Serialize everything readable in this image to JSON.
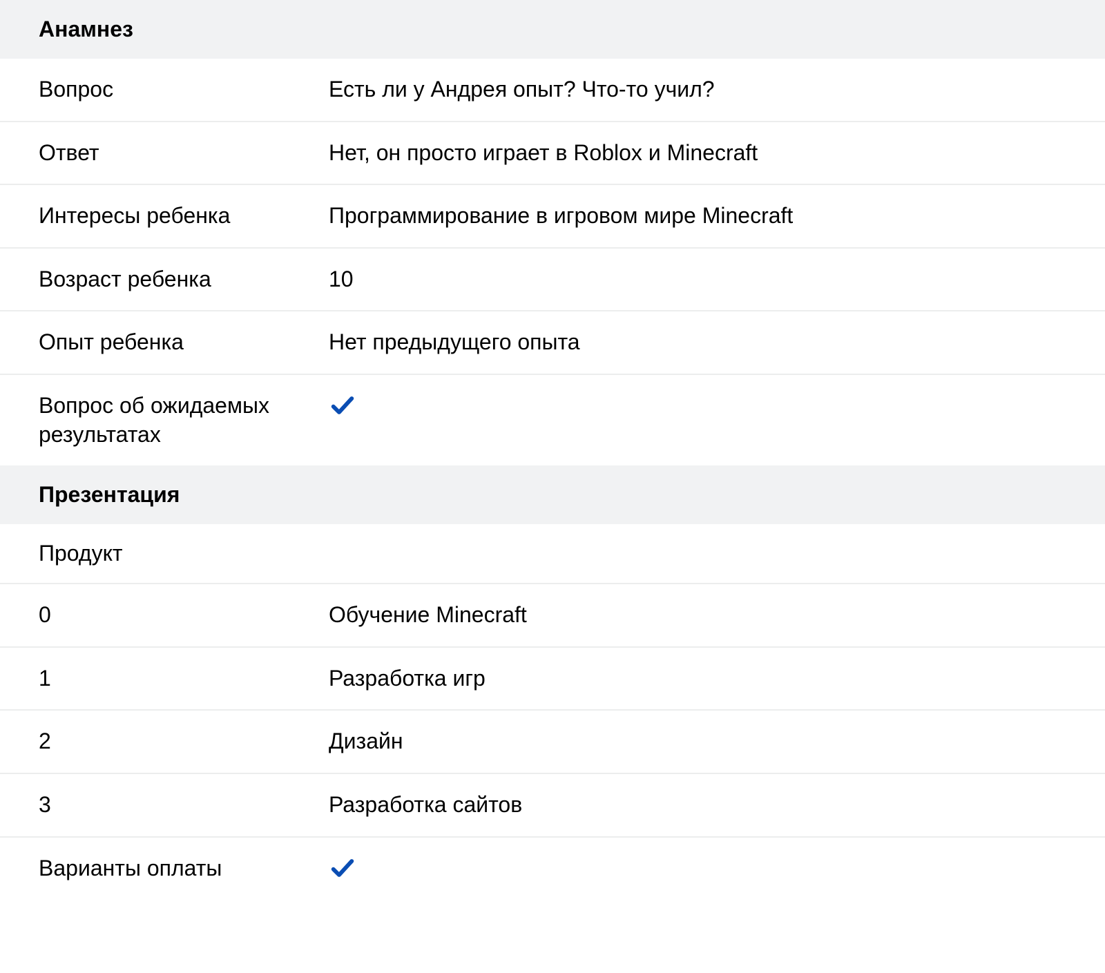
{
  "sections": {
    "anamnesis": {
      "title": "Анамнез",
      "rows": [
        {
          "label": "Вопрос",
          "value": "Есть ли у Андрея опыт? Что-то учил?"
        },
        {
          "label": "Ответ",
          "value": "Нет, он просто играет в Roblox и Minecraft"
        },
        {
          "label": "Интересы ребенка",
          "value": "Программирование в игровом мире Minecraft"
        },
        {
          "label": "Возраст ребенка",
          "value": "10"
        },
        {
          "label": "Опыт ребенка",
          "value": "Нет предыдущего опыта"
        },
        {
          "label": "Вопрос об ожидаемых результатах",
          "value_type": "check",
          "checked": true
        }
      ]
    },
    "presentation": {
      "title": "Презентация",
      "subheader": "Продукт",
      "products": [
        {
          "index": "0",
          "value": "Обучение Minecraft"
        },
        {
          "index": "1",
          "value": "Разработка игр"
        },
        {
          "index": "2",
          "value": "Дизайн"
        },
        {
          "index": "3",
          "value": "Разработка сайтов"
        }
      ],
      "payment_options": {
        "label": "Варианты оплаты",
        "value_type": "check",
        "checked": true
      }
    }
  },
  "colors": {
    "check": "#0a4db3"
  }
}
